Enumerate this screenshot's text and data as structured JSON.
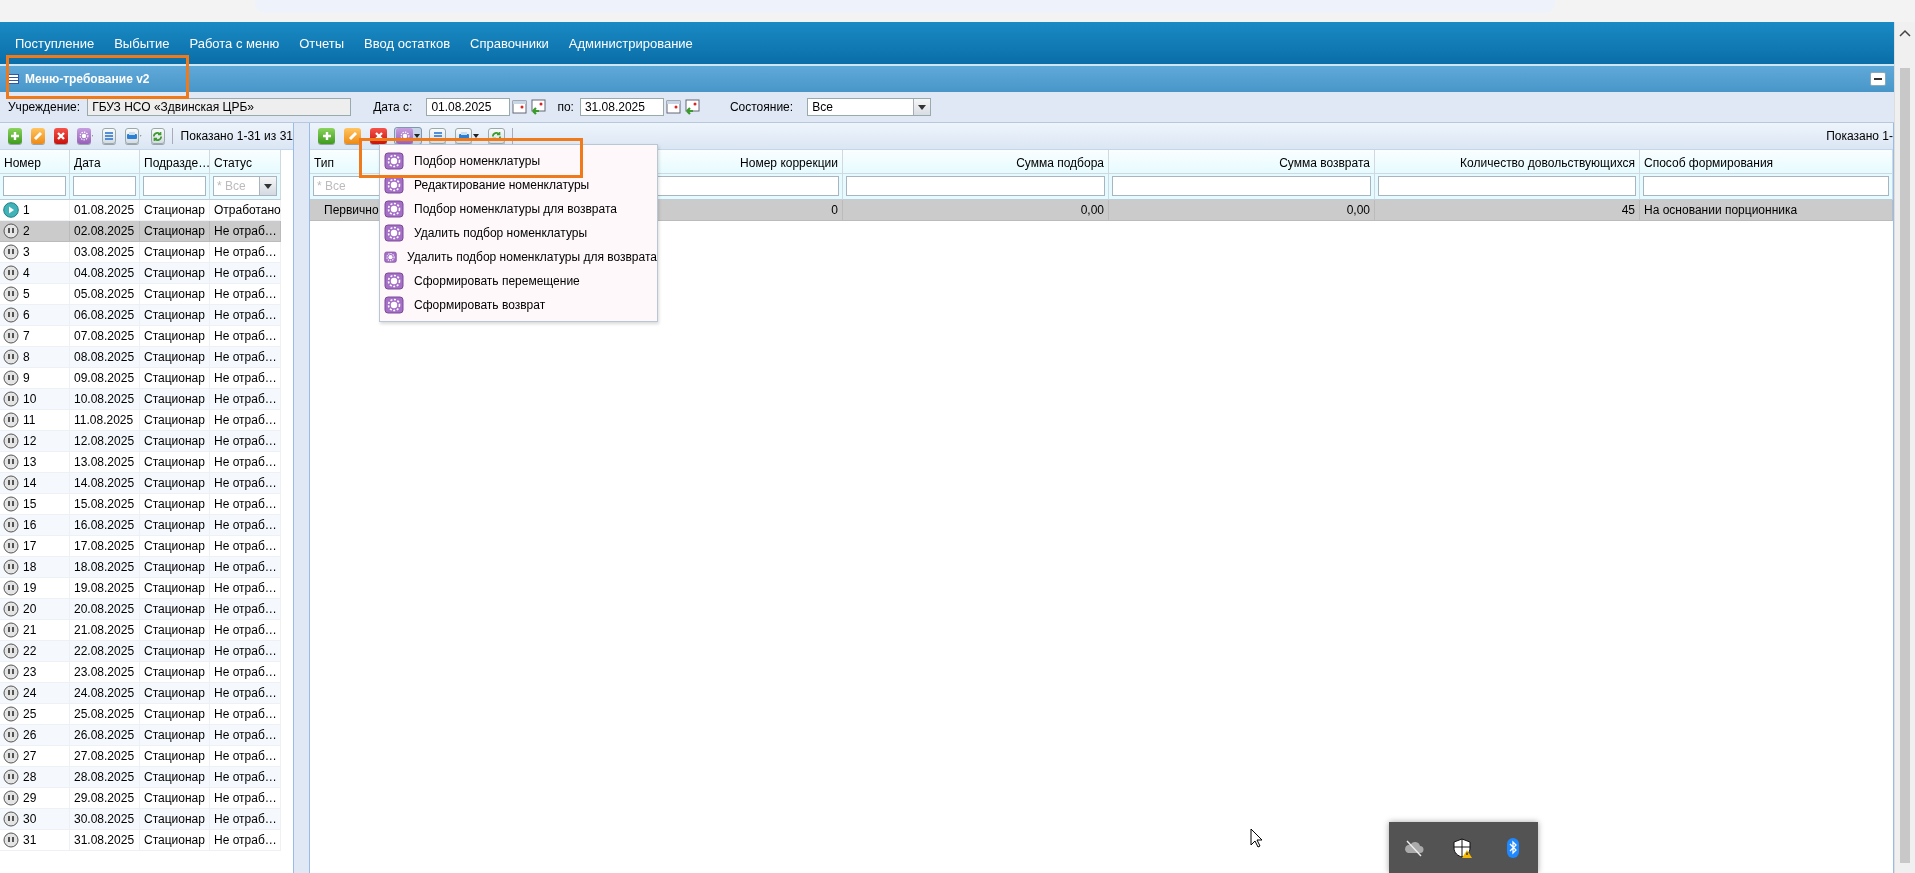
{
  "menu_bar": {
    "items": [
      "Поступление",
      "Выбытие",
      "Работа с меню",
      "Отчеты",
      "Ввод остатков",
      "Справочники",
      "Администрирование"
    ]
  },
  "window": {
    "title": "Меню-требование v2"
  },
  "filters": {
    "institution_label": "Учреждение:",
    "institution": "ГБУЗ НСО «Здвинская ЦРБ»",
    "date_from_label": "Дата с:",
    "date_from": "01.08.2025",
    "date_to_label": "по:",
    "date_to": "31.08.2025",
    "state_label": "Состояние:",
    "state": "Все"
  },
  "left_grid": {
    "paging": "Показано 1-31 из 31",
    "columns": [
      "Номер",
      "Дата",
      "Подразде…",
      "Статус"
    ],
    "status_filter_placeholder": "* Все",
    "rows": [
      {
        "number": "1",
        "date": "01.08.2025",
        "department": "Стационар",
        "status": "Отработано",
        "kind": "done",
        "selected": false
      },
      {
        "number": "2",
        "date": "02.08.2025",
        "department": "Стационар",
        "status": "Не отраб…",
        "kind": "pending",
        "selected": true
      },
      {
        "number": "3",
        "date": "03.08.2025",
        "department": "Стационар",
        "status": "Не отраб…",
        "kind": "pending",
        "selected": false
      },
      {
        "number": "4",
        "date": "04.08.2025",
        "department": "Стационар",
        "status": "Не отраб…",
        "kind": "pending",
        "selected": false
      },
      {
        "number": "5",
        "date": "05.08.2025",
        "department": "Стационар",
        "status": "Не отраб…",
        "kind": "pending",
        "selected": false
      },
      {
        "number": "6",
        "date": "06.08.2025",
        "department": "Стационар",
        "status": "Не отраб…",
        "kind": "pending",
        "selected": false
      },
      {
        "number": "7",
        "date": "07.08.2025",
        "department": "Стационар",
        "status": "Не отраб…",
        "kind": "pending",
        "selected": false
      },
      {
        "number": "8",
        "date": "08.08.2025",
        "department": "Стационар",
        "status": "Не отраб…",
        "kind": "pending",
        "selected": false
      },
      {
        "number": "9",
        "date": "09.08.2025",
        "department": "Стационар",
        "status": "Не отраб…",
        "kind": "pending",
        "selected": false
      },
      {
        "number": "10",
        "date": "10.08.2025",
        "department": "Стационар",
        "status": "Не отраб…",
        "kind": "pending",
        "selected": false
      },
      {
        "number": "11",
        "date": "11.08.2025",
        "department": "Стационар",
        "status": "Не отраб…",
        "kind": "pending",
        "selected": false
      },
      {
        "number": "12",
        "date": "12.08.2025",
        "department": "Стационар",
        "status": "Не отраб…",
        "kind": "pending",
        "selected": false
      },
      {
        "number": "13",
        "date": "13.08.2025",
        "department": "Стационар",
        "status": "Не отраб…",
        "kind": "pending",
        "selected": false
      },
      {
        "number": "14",
        "date": "14.08.2025",
        "department": "Стационар",
        "status": "Не отраб…",
        "kind": "pending",
        "selected": false
      },
      {
        "number": "15",
        "date": "15.08.2025",
        "department": "Стационар",
        "status": "Не отраб…",
        "kind": "pending",
        "selected": false
      },
      {
        "number": "16",
        "date": "16.08.2025",
        "department": "Стационар",
        "status": "Не отраб…",
        "kind": "pending",
        "selected": false
      },
      {
        "number": "17",
        "date": "17.08.2025",
        "department": "Стационар",
        "status": "Не отраб…",
        "kind": "pending",
        "selected": false
      },
      {
        "number": "18",
        "date": "18.08.2025",
        "department": "Стационар",
        "status": "Не отраб…",
        "kind": "pending",
        "selected": false
      },
      {
        "number": "19",
        "date": "19.08.2025",
        "department": "Стационар",
        "status": "Не отраб…",
        "kind": "pending",
        "selected": false
      },
      {
        "number": "20",
        "date": "20.08.2025",
        "department": "Стационар",
        "status": "Не отраб…",
        "kind": "pending",
        "selected": false
      },
      {
        "number": "21",
        "date": "21.08.2025",
        "department": "Стационар",
        "status": "Не отраб…",
        "kind": "pending",
        "selected": false
      },
      {
        "number": "22",
        "date": "22.08.2025",
        "department": "Стационар",
        "status": "Не отраб…",
        "kind": "pending",
        "selected": false
      },
      {
        "number": "23",
        "date": "23.08.2025",
        "department": "Стационар",
        "status": "Не отраб…",
        "kind": "pending",
        "selected": false
      },
      {
        "number": "24",
        "date": "24.08.2025",
        "department": "Стационар",
        "status": "Не отраб…",
        "kind": "pending",
        "selected": false
      },
      {
        "number": "25",
        "date": "25.08.2025",
        "department": "Стационар",
        "status": "Не отраб…",
        "kind": "pending",
        "selected": false
      },
      {
        "number": "26",
        "date": "26.08.2025",
        "department": "Стационар",
        "status": "Не отраб…",
        "kind": "pending",
        "selected": false
      },
      {
        "number": "27",
        "date": "27.08.2025",
        "department": "Стационар",
        "status": "Не отраб…",
        "kind": "pending",
        "selected": false
      },
      {
        "number": "28",
        "date": "28.08.2025",
        "department": "Стационар",
        "status": "Не отраб…",
        "kind": "pending",
        "selected": false
      },
      {
        "number": "29",
        "date": "29.08.2025",
        "department": "Стационар",
        "status": "Не отраб…",
        "kind": "pending",
        "selected": false
      },
      {
        "number": "30",
        "date": "30.08.2025",
        "department": "Стационар",
        "status": "Не отраб…",
        "kind": "pending",
        "selected": false
      },
      {
        "number": "31",
        "date": "31.08.2025",
        "department": "Стационар",
        "status": "Не отраб…",
        "kind": "pending",
        "selected": false
      }
    ]
  },
  "right_grid": {
    "paging": "Показано 1-",
    "columns": [
      "Тип",
      "Номер коррекции",
      "Сумма подбора",
      "Сумма возврата",
      "Количество довольствующихся",
      "Способ формирования"
    ],
    "type_filter_placeholder": "* Все",
    "rows": [
      {
        "cells": [
          "Первично",
          "0",
          "0,00",
          "0,00",
          "45",
          "На основании порционника"
        ],
        "selected": true
      }
    ]
  },
  "actions_menu": {
    "open": true,
    "items": [
      "Подбор номенклатуры",
      "Редактирование номенклатуры",
      "Подбор номенклатуры для возврата",
      "Удалить подбор номенклатуры",
      "Удалить подбор номенклатуры для возврата",
      "Сформировать перемещение",
      "Сформировать возврат"
    ]
  }
}
